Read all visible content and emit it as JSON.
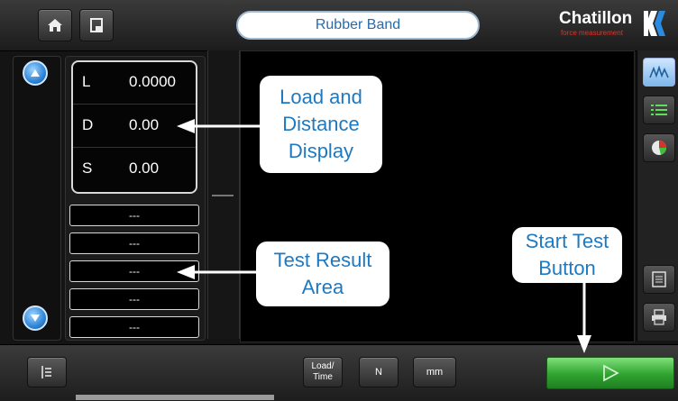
{
  "header": {
    "title": "Rubber Band",
    "logo_text": "Chatillon",
    "logo_tagline": "force measurement",
    "icons": [
      "home-icon",
      "page-icon"
    ]
  },
  "readings": [
    {
      "label": "L",
      "value": "0.0000"
    },
    {
      "label": "D",
      "value": "0.00"
    },
    {
      "label": "S",
      "value": "0.00"
    }
  ],
  "results": [
    "---",
    "---",
    "---",
    "---",
    "---"
  ],
  "right_toolbar": {
    "icons": [
      "graph-view-icon",
      "list-view-icon",
      "pie-chart-icon",
      "report-icon",
      "print-icon"
    ]
  },
  "bottom": {
    "mode_label_1": "Load/",
    "mode_label_2": "Time",
    "unit_load": "N",
    "unit_distance": "mm",
    "icons": [
      "sort-icon",
      "play-icon"
    ]
  },
  "annotations": {
    "load_distance": "Load and\nDistance\nDisplay",
    "test_result": "Test Result\nArea",
    "start_test": "Start Test\nButton"
  },
  "colors": {
    "accent_blue": "#1f79c0",
    "start_green": "#2fa32f",
    "title_text": "#2a6aa8"
  }
}
